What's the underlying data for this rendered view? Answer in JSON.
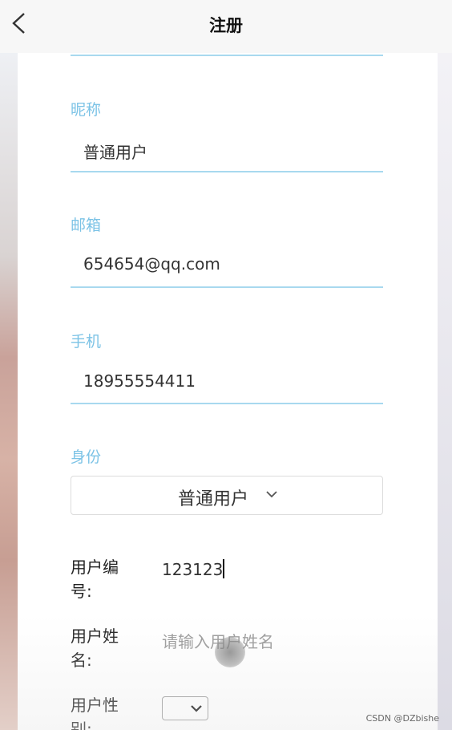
{
  "header": {
    "title": "注册",
    "back_icon": "chevron-left-icon"
  },
  "form": {
    "nickname": {
      "label": "昵称",
      "value": "普通用户"
    },
    "email": {
      "label": "邮箱",
      "value": "654654@qq.com"
    },
    "phone": {
      "label": "手机",
      "value": "18955554411"
    },
    "identity": {
      "label": "身份",
      "selected": "普通用户",
      "icon": "chevron-down-icon"
    },
    "user_no": {
      "label_line1": "用户编",
      "label_line2": "号:",
      "value": "123123"
    },
    "user_name": {
      "label_line1": "用户姓",
      "label_line2": "名:",
      "placeholder": "请输入用户姓名"
    },
    "user_gender": {
      "label_line1": "用户性",
      "label_line2": "别:",
      "selected": ""
    }
  },
  "watermark": "CSDN @DZbishe",
  "colors": {
    "accent": "#7cc3e6",
    "underline": "#a8d9ef"
  }
}
